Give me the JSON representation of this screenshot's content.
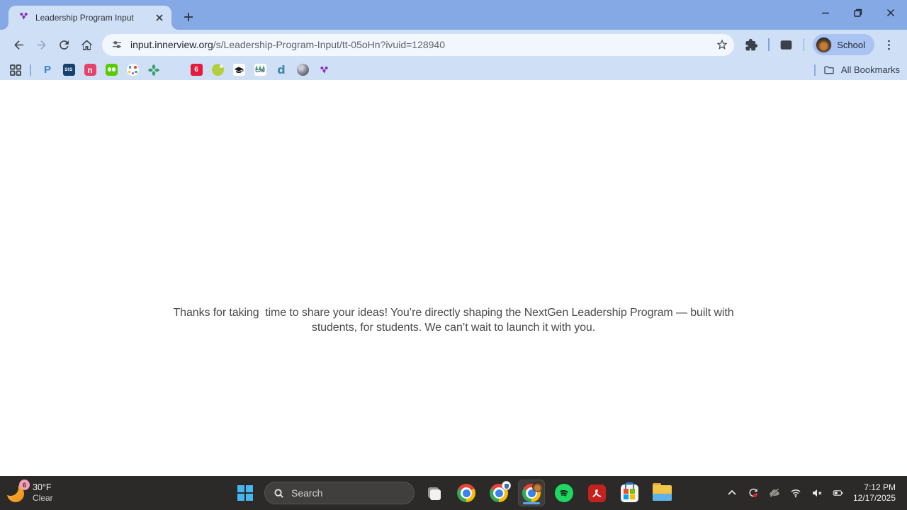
{
  "tab": {
    "title": "Leadership Program Input"
  },
  "toolbar": {
    "url_domain": "input.innerview.org",
    "url_path": "/s/Leadership-Program-Input/tt-05oHn?ivuid=128940",
    "profile_label": "School"
  },
  "bookmarks_bar": {
    "all_bookmarks_label": "All Bookmarks",
    "icon_labels": {
      "powerschool": "P",
      "sis": "SIS",
      "n_site": "n",
      "red_six": "6",
      "cpm": "CPM",
      "blue_d": "d"
    }
  },
  "page": {
    "message_line1": "Thanks for taking  time to share your ideas! You’re directly shaping the NextGen Leadership Program — built with",
    "message_line2": "students, for students. We can’t wait to launch it with you."
  },
  "taskbar": {
    "weather_badge": "6",
    "weather_temp": "30°F",
    "weather_condition": "Clear",
    "search_placeholder": "Search",
    "clock_time": "7:12 PM",
    "clock_date": "12/17/2025"
  },
  "colors": {
    "tab_strip": "#85a9e4",
    "toolbar_bg": "#cfdff6",
    "url_pill_bg": "#f2f6fd",
    "taskbar_bg": "#2b2a28",
    "active_indicator": "#5aa7f0",
    "page_bg": "#ffffff",
    "message_text": "#4a4a4a"
  }
}
